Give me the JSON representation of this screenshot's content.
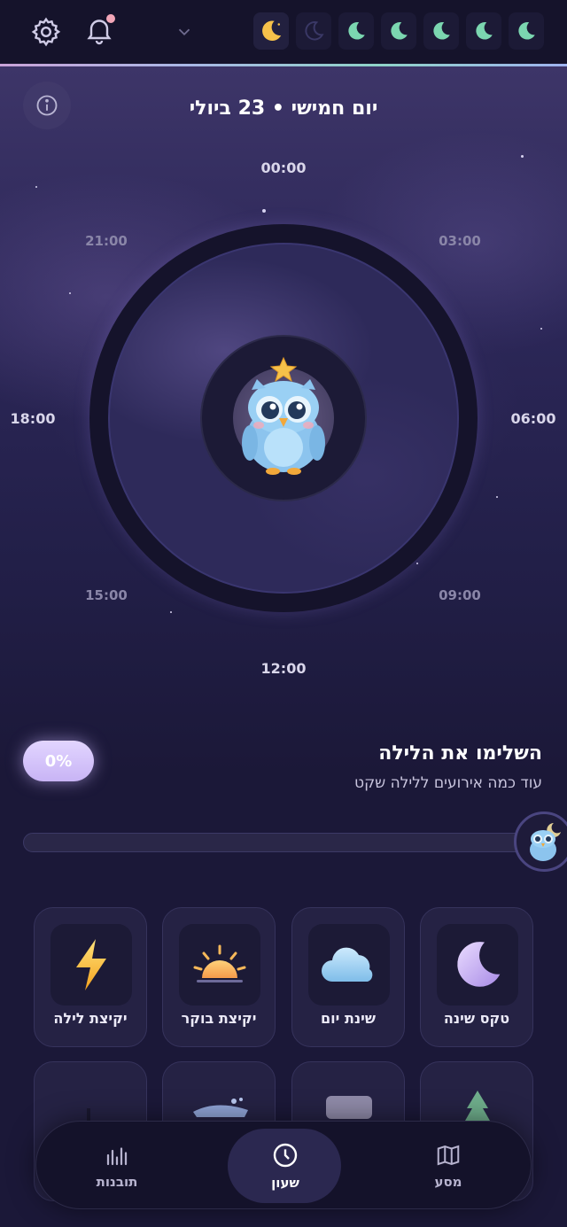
{
  "header": {
    "settings_icon": "gear-icon",
    "notifications_icon": "bell-icon",
    "notification_dot_color": "#f2a6b8",
    "dropdown_icon": "chevron-down-icon",
    "moon_streak": [
      {
        "state": "inactive",
        "color": "#7bd6b0"
      },
      {
        "state": "inactive",
        "color": "#7bd6b0"
      },
      {
        "state": "inactive",
        "color": "#7bd6b0"
      },
      {
        "state": "inactive",
        "color": "#7bd6b0"
      },
      {
        "state": "inactive",
        "color": "#7bd6b0"
      },
      {
        "state": "empty",
        "color": "#3a3866"
      },
      {
        "state": "current",
        "color": "#f6c14a"
      }
    ]
  },
  "clock": {
    "date_title": "יום חמישי • 23 ביולי",
    "hours": {
      "h00": "00:00",
      "h03": "03:00",
      "h06": "06:00",
      "h09": "09:00",
      "h12": "12:00",
      "h15": "15:00",
      "h18": "18:00",
      "h21": "21:00"
    },
    "mascot": "owl-mascot"
  },
  "progress": {
    "percent_label": "0%",
    "percent": 0,
    "title": "השלימו את הלילה",
    "subtitle": "עוד כמה אירועים ללילה שקט"
  },
  "events": [
    {
      "label": "טקס שינה",
      "icon": "moon-icon"
    },
    {
      "label": "שינת יום",
      "icon": "cloud-icon"
    },
    {
      "label": "יקיצת בוקר",
      "icon": "sunrise-icon"
    },
    {
      "label": "יקיצת לילה",
      "icon": "lightning-icon"
    }
  ],
  "nav": {
    "items": [
      {
        "label": "מסע",
        "icon": "map-icon",
        "active": false
      },
      {
        "label": "שעון",
        "icon": "clock-icon",
        "active": true
      },
      {
        "label": "תובנות",
        "icon": "bar-chart-icon",
        "active": false
      }
    ]
  },
  "colors": {
    "accent": "#c8b4f5",
    "background": "#1b1838",
    "card": "#252244"
  }
}
